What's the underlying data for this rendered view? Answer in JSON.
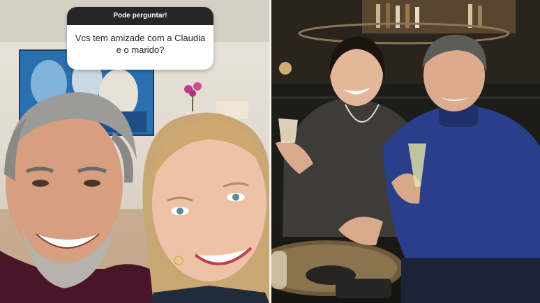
{
  "story_question": {
    "header": "Pode perguntar!",
    "question": "Vcs tem amizade com a Claudia e o marido?"
  },
  "colors": {
    "card_header": "#262626",
    "card_body": "#ffffff",
    "divider": "#f4f1ec"
  },
  "icons": [
    "sun-glare"
  ]
}
